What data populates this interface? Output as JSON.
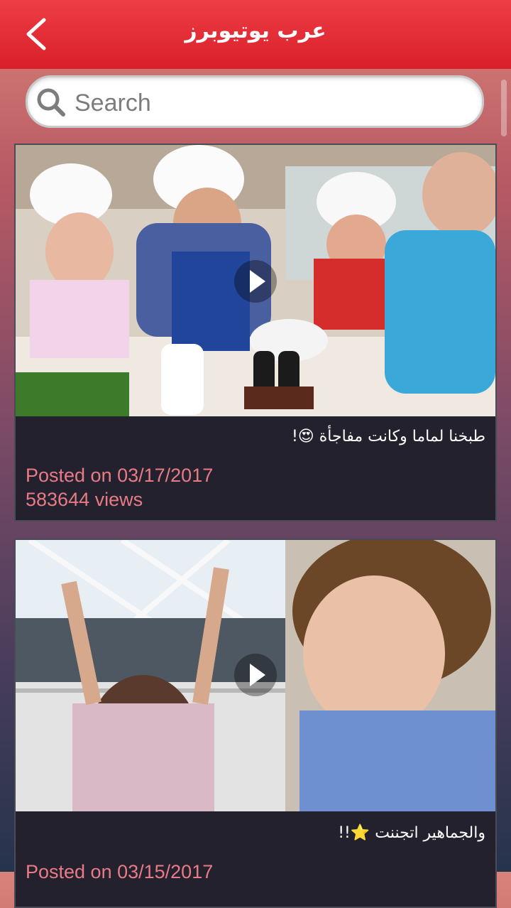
{
  "app_bar": {
    "title": "عرب يوتيوبرز"
  },
  "search": {
    "placeholder": "Search",
    "value": ""
  },
  "colors": {
    "app_bar": "#e52a33",
    "card_bg": "#23212d",
    "meta_text": "#e87b85"
  },
  "videos": [
    {
      "title": "طبخنا لماما وكانت مفاجأة",
      "title_suffix": "😍!",
      "posted": "Posted on 03/17/2017",
      "views": "583644 views"
    },
    {
      "title": "والجماهير اتجننت",
      "title_suffix": "⭐!!",
      "posted": "Posted on 03/15/2017"
    }
  ]
}
